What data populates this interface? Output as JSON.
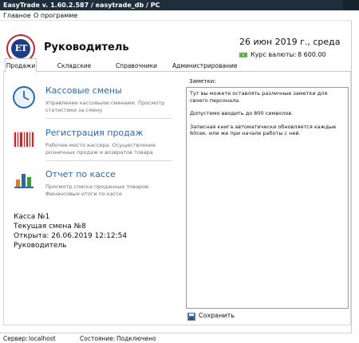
{
  "window": {
    "title": "EasyTrade v. 1.60.2.587 / easytrade_db / PC"
  },
  "menu": {
    "items": [
      "Главное",
      "О программе"
    ]
  },
  "header": {
    "logo_text": "ET",
    "role": "Руководитель",
    "date": "26 июн 2019 г., среда",
    "rate_label": "Курс валюты:",
    "rate_value": "8 600.00",
    "rate_icon": "money-bill-icon"
  },
  "tabs": [
    {
      "label": "Продажи",
      "active": true
    },
    {
      "label": "Складские операции",
      "active": false
    },
    {
      "label": "Справочники",
      "active": false
    },
    {
      "label": "Администрирование",
      "active": false
    }
  ],
  "sections": [
    {
      "title": "Кассовые смены",
      "description": "Управление кассовыми сменами. Просмотр статистики за смену",
      "icon": "clock-icon"
    },
    {
      "title": "Регистрация продаж",
      "description": "Рабочее место кассира. Осуществление розничных продаж и возвратов товара",
      "icon": "barcode-icon"
    },
    {
      "title": "Отчет по кассе",
      "description": "Просмотр списка проданных товаров. Финансовые итоги по кассе",
      "icon": "report-icon"
    }
  ],
  "cash_info": {
    "register": "Касса №1",
    "shift": "Текущая смена №8",
    "opened": "Открыта: 26.06.2019 12:12:54",
    "user": "Руководитель"
  },
  "notes": {
    "label": "Заметки:",
    "lines": [
      "Тут вы можете оставлять различные заметки для своего персонала.",
      "Допустимо вводить до 800 символов.",
      "Записная книга автоматически обновляется каждые 60сек. или же при начале работы с ней."
    ]
  },
  "save_button": {
    "label": "Сохранить",
    "icon": "save-icon"
  },
  "status": {
    "server_label": "Сервер:",
    "server_value": "localhost",
    "state_label": "Состояние:",
    "state_value": "Подключено"
  },
  "colors": {
    "accent_blue": "#2b67b1",
    "logo_red": "#c4252b",
    "logo_blue": "#1d3d86",
    "titlebar": "#1f2e3a"
  }
}
